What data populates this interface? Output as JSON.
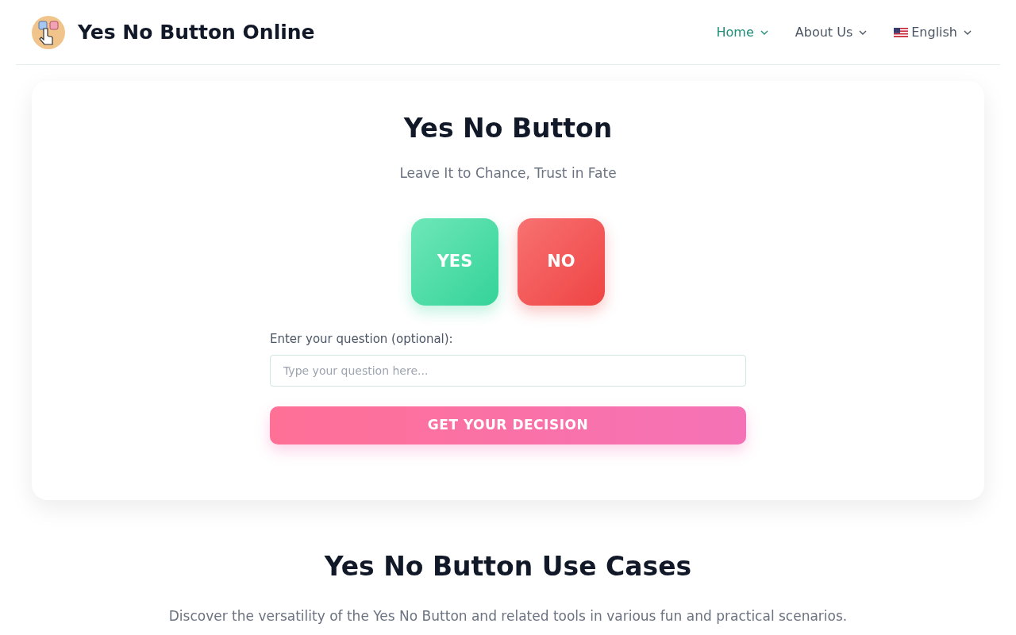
{
  "header": {
    "site_title": "Yes No Button Online",
    "nav": [
      {
        "label": "Home",
        "selected": true,
        "kind": "menu"
      },
      {
        "label": "About Us",
        "selected": false,
        "kind": "menu"
      },
      {
        "label": "English",
        "selected": false,
        "kind": "language"
      }
    ]
  },
  "tool": {
    "title": "Yes No Button",
    "subtitle": "Leave It to Chance, Trust in Fate",
    "choices": [
      {
        "label": "YES",
        "kind": "yes"
      },
      {
        "label": "NO",
        "kind": "no"
      }
    ],
    "question": {
      "label": "Enter your question (optional):",
      "placeholder": "Type your question here..."
    },
    "submit": "GET YOUR DECISION"
  },
  "use_cases": {
    "title": "Yes No Button Use Cases",
    "intro": "Discover the versatility of the Yes No Button and related tools in various fun and practical scenarios."
  }
}
